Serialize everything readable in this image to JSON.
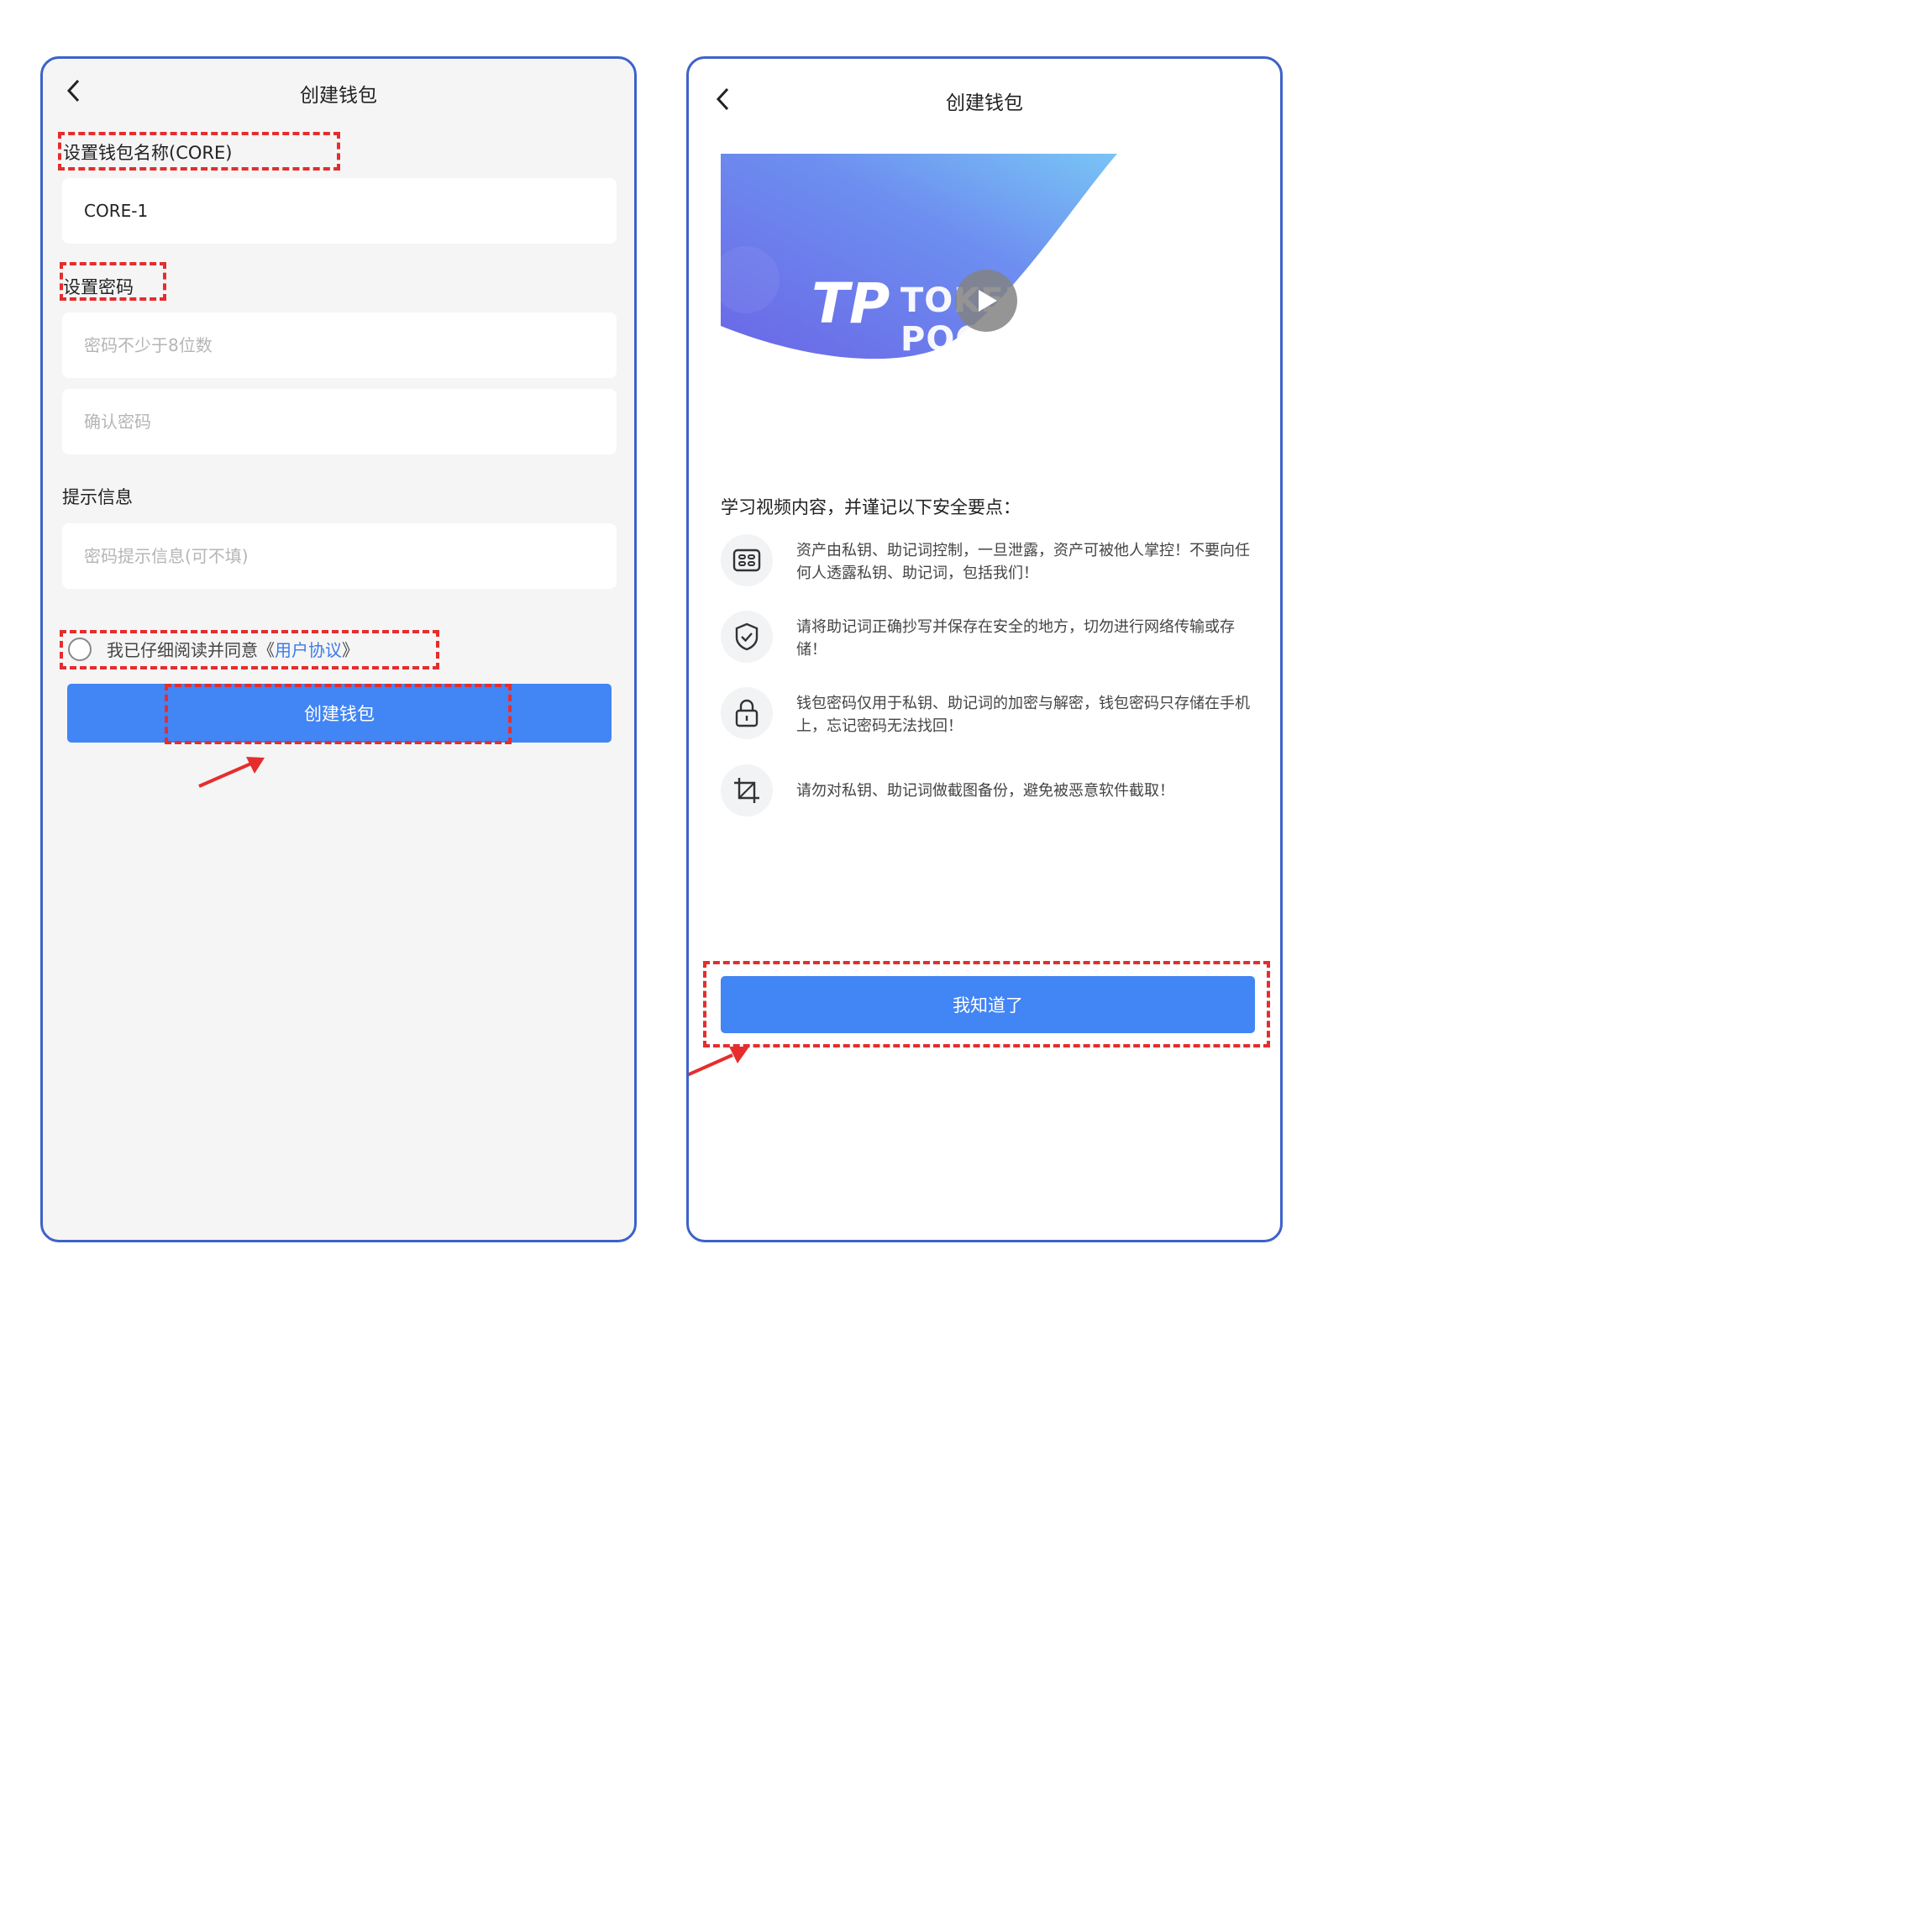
{
  "left_screen": {
    "title": "创建钱包",
    "wallet_name_label": "设置钱包名称(CORE)",
    "wallet_name_value": "CORE-1",
    "password_label": "设置密码",
    "password_placeholder": "密码不少于8位数",
    "confirm_placeholder": "确认密码",
    "hint_label": "提示信息",
    "hint_placeholder": "密码提示信息(可不填)",
    "agree_text": "我已仔细阅读并同意《",
    "agree_link": "用户协议",
    "agree_suffix": "》",
    "create_button": "创建钱包"
  },
  "right_screen": {
    "title": "创建钱包",
    "banner_brand": "TOKEN POCKET",
    "banner_logo": "TP",
    "intro": "学习视频内容，并谨记以下安全要点：",
    "tips": [
      {
        "icon": "keys-icon",
        "text": "资产由私钥、助记词控制，一旦泄露，资产可被他人掌控！不要向任何人透露私钥、助记词，包括我们！"
      },
      {
        "icon": "shield-check-icon",
        "text": "请将助记词正确抄写并保存在安全的地方，切勿进行网络传输或存储！"
      },
      {
        "icon": "lock-icon",
        "text": "钱包密码仅用于私钥、助记词的加密与解密，钱包密码只存储在手机上，忘记密码无法找回！"
      },
      {
        "icon": "crop-icon",
        "text": "请勿对私钥、助记词做截图备份，避免被恶意软件截取！"
      }
    ],
    "confirm_button": "我知道了"
  },
  "colors": {
    "primary": "#4285f4",
    "frame": "#3d62c9",
    "annotation": "#e52d2d",
    "link": "#3b7be8"
  }
}
